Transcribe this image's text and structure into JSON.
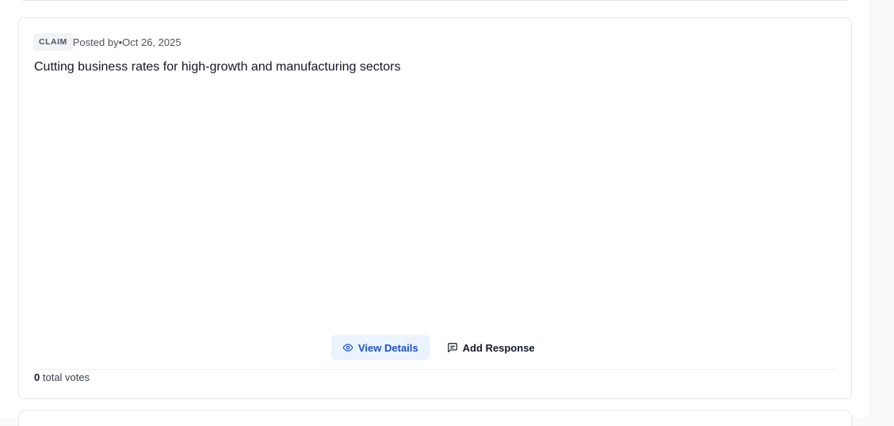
{
  "card": {
    "tag": "CLAIM",
    "posted_by_label": "Posted by",
    "separator": "•",
    "date": "Oct 26, 2025",
    "title": "Cutting business rates for high-growth and manufacturing sectors",
    "actions": {
      "view_details_label": "View Details",
      "view_details_icon": "eye-icon",
      "add_response_label": "Add Response",
      "add_response_icon": "message-square-icon"
    },
    "votes": {
      "count": "0",
      "label": "total votes"
    }
  },
  "colors": {
    "accent": "#1d4ed8",
    "accent_bg": "#eaf3fe",
    "border": "#e5e7eb",
    "tag_bg": "#f1f3f5"
  }
}
